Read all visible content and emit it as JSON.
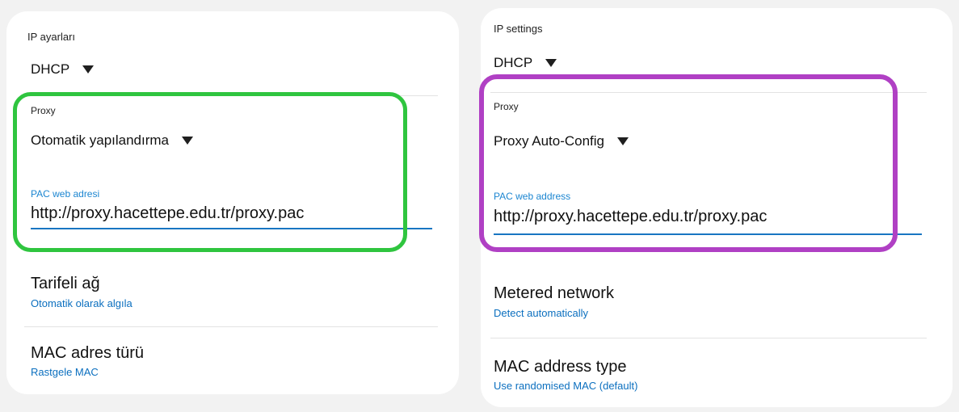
{
  "left": {
    "ip_settings_label": "IP ayarları",
    "ip_mode": "DHCP",
    "proxy_label": "Proxy",
    "proxy_mode": "Otomatik yapılandırma",
    "pac_label": "PAC web adresi",
    "pac_url": "http://proxy.hacettepe.edu.tr/proxy.pac",
    "metered_title": "Tarifeli ağ",
    "metered_value": "Otomatik olarak algıla",
    "mac_title": "MAC adres türü",
    "mac_value": "Rastgele MAC",
    "highlight_color": "#2fc53f"
  },
  "right": {
    "ip_settings_label": "IP settings",
    "ip_mode": "DHCP",
    "proxy_label": "Proxy",
    "proxy_mode": "Proxy Auto-Config",
    "pac_label": "PAC web address",
    "pac_url": "http://proxy.hacettepe.edu.tr/proxy.pac",
    "metered_title": "Metered network",
    "metered_value": "Detect automatically",
    "mac_title": "MAC address type",
    "mac_value": "Use randomised MAC (default)",
    "highlight_color": "#b040c4"
  },
  "colors": {
    "accent_blue": "#1976c2",
    "link_blue": "#0b6fbf",
    "card_bg": "#ffffff",
    "page_bg": "#f2f2f2"
  },
  "icons": {
    "dropdown": "caret-down-icon"
  }
}
